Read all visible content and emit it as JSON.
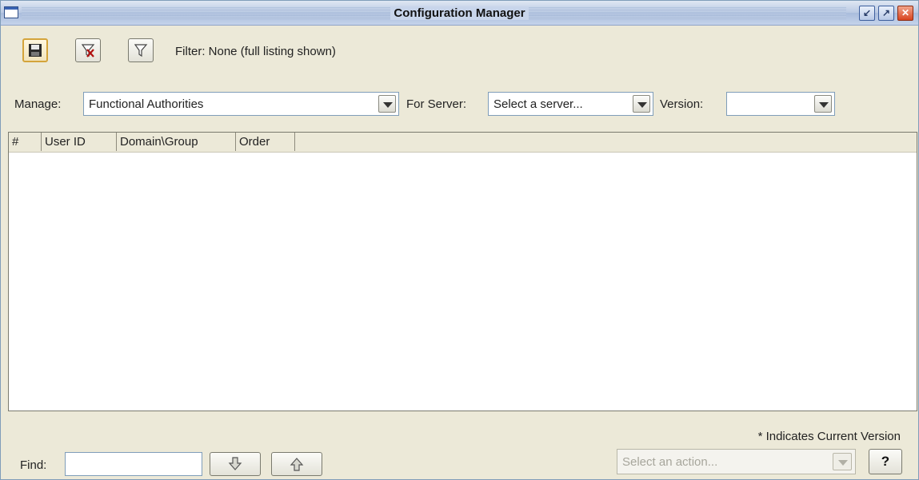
{
  "window": {
    "title": "Configuration Manager",
    "controls": {
      "minimize": "↙",
      "maximize": "↗",
      "close": "✕"
    }
  },
  "toolbar": {
    "buttons": [
      {
        "name": "save",
        "icon": "floppy-disk-icon"
      },
      {
        "name": "clear-filter",
        "icon": "filter-clear-icon"
      },
      {
        "name": "filter",
        "icon": "filter-icon"
      }
    ],
    "filter_text": "Filter: None (full listing shown)"
  },
  "selectors": {
    "manage_label": "Manage:",
    "manage_value": "Functional Authorities",
    "server_label": "For Server:",
    "server_value": "Select a server...",
    "version_label": "Version:",
    "version_value": ""
  },
  "table": {
    "columns": [
      "#",
      "User ID",
      "Domain\\Group",
      "Order"
    ],
    "rows": []
  },
  "footer": {
    "note": "* Indicates Current Version",
    "find_label": "Find:",
    "find_value": "",
    "action_placeholder": "Select an action...",
    "help_label": "?"
  }
}
